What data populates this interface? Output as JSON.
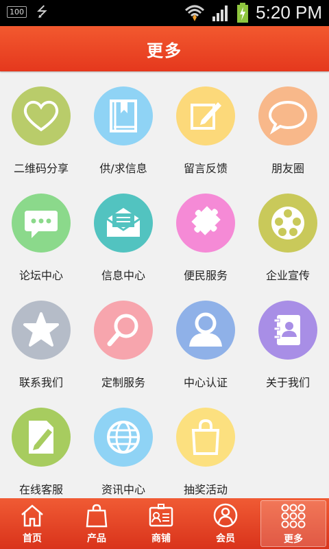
{
  "status_bar": {
    "battery_badge": "100",
    "time": "5:20 PM"
  },
  "header": {
    "title": "更多"
  },
  "grid": {
    "items": [
      {
        "label": "二维码分享",
        "icon": "heart-icon",
        "color": "#b9cc6a"
      },
      {
        "label": "供/求信息",
        "icon": "book-icon",
        "color": "#8fd3f5"
      },
      {
        "label": "留言反馈",
        "icon": "edit-note-icon",
        "color": "#fcd97a"
      },
      {
        "label": "朋友圈",
        "icon": "speech-bubble-icon",
        "color": "#f8b88a"
      },
      {
        "label": "论坛中心",
        "icon": "chat-icon",
        "color": "#8bd98b"
      },
      {
        "label": "信息中心",
        "icon": "envelope-icon",
        "color": "#52c3c0"
      },
      {
        "label": "便民服务",
        "icon": "puzzle-icon",
        "color": "#f58ad6"
      },
      {
        "label": "企业宣传",
        "icon": "film-reel-icon",
        "color": "#c9c95a"
      },
      {
        "label": "联系我们",
        "icon": "star-icon",
        "color": "#b5bcc8"
      },
      {
        "label": "定制服务",
        "icon": "magnifier-icon",
        "color": "#f7a5ad"
      },
      {
        "label": "中心认证",
        "icon": "user-icon",
        "color": "#8fb1e8"
      },
      {
        "label": "关于我们",
        "icon": "contact-book-icon",
        "color": "#a88ee6"
      },
      {
        "label": "在线客服",
        "icon": "document-edit-icon",
        "color": "#a7cc5f"
      },
      {
        "label": "资讯中心",
        "icon": "globe-icon",
        "color": "#8fd3f5"
      },
      {
        "label": "抽奖活动",
        "icon": "shopping-bag-icon",
        "color": "#fce07f"
      }
    ]
  },
  "bottom_nav": {
    "items": [
      {
        "label": "首页",
        "icon": "home-icon"
      },
      {
        "label": "产品",
        "icon": "bag-icon"
      },
      {
        "label": "商铺",
        "icon": "shop-card-icon"
      },
      {
        "label": "会员",
        "icon": "member-icon"
      },
      {
        "label": "更多",
        "icon": "grid-dots-icon",
        "active": true
      }
    ]
  }
}
